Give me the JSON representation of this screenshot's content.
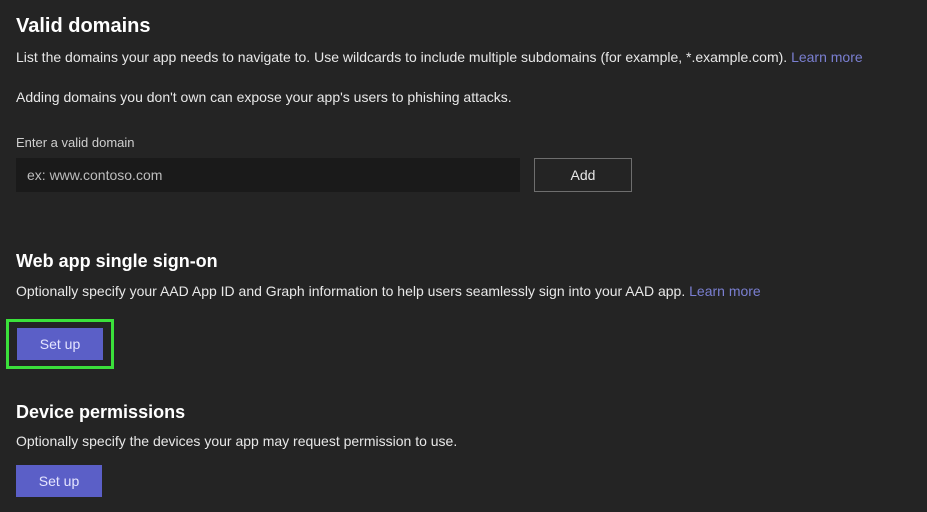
{
  "validDomains": {
    "title": "Valid domains",
    "descPrefix": "List the domains your app needs to navigate to. Use wildcards to include multiple subdomains (for example, *.example.com). ",
    "learnMore": "Learn more",
    "warning": "Adding domains you don't own can expose your app's users to phishing attacks.",
    "fieldLabel": "Enter a valid domain",
    "placeholder": "ex: www.contoso.com",
    "addButton": "Add"
  },
  "sso": {
    "title": "Web app single sign-on",
    "descPrefix": "Optionally specify your AAD App ID and Graph information to help users seamlessly sign into your AAD app. ",
    "learnMore": "Learn more",
    "setup": "Set up"
  },
  "device": {
    "title": "Device permissions",
    "desc": "Optionally specify the devices your app may request permission to use.",
    "setup": "Set up"
  }
}
